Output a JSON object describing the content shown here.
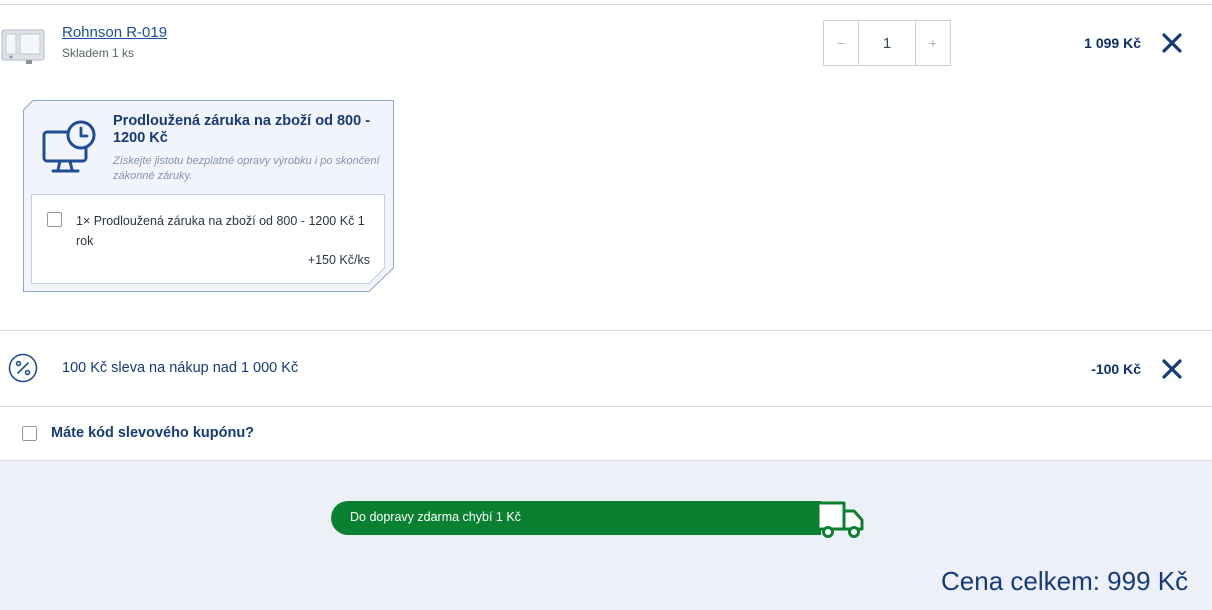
{
  "product": {
    "name": "Rohnson R-019",
    "stock": "Skladem 1 ks",
    "quantity": "1",
    "minus": "−",
    "plus": "+",
    "price": "1 099 Kč"
  },
  "warranty": {
    "title": "Prodloužená záruka na zboží od 800 - 1200 Kč",
    "description": "Získejte jistotu bezplatné opravy výrobku i po skončení zákonné záruky.",
    "option_label": "1× Prodloužená záruka na zboží od 800 - 1200 Kč 1 rok",
    "option_price": "+150 Kč/ks"
  },
  "discount": {
    "label": "100 Kč sleva na nákup nad 1 000 Kč",
    "price": "-100 Kč"
  },
  "coupon": {
    "label": "Máte kód slevového kupónu?"
  },
  "shipping": {
    "text": "Do dopravy zdarma chybí 1 Kč",
    "progress": 0.999
  },
  "total": {
    "text": "Cena celkem: 999 Kč"
  },
  "colors": {
    "primary": "#153b7a",
    "green": "#0a8131",
    "footer_bg": "#edf0f6"
  }
}
